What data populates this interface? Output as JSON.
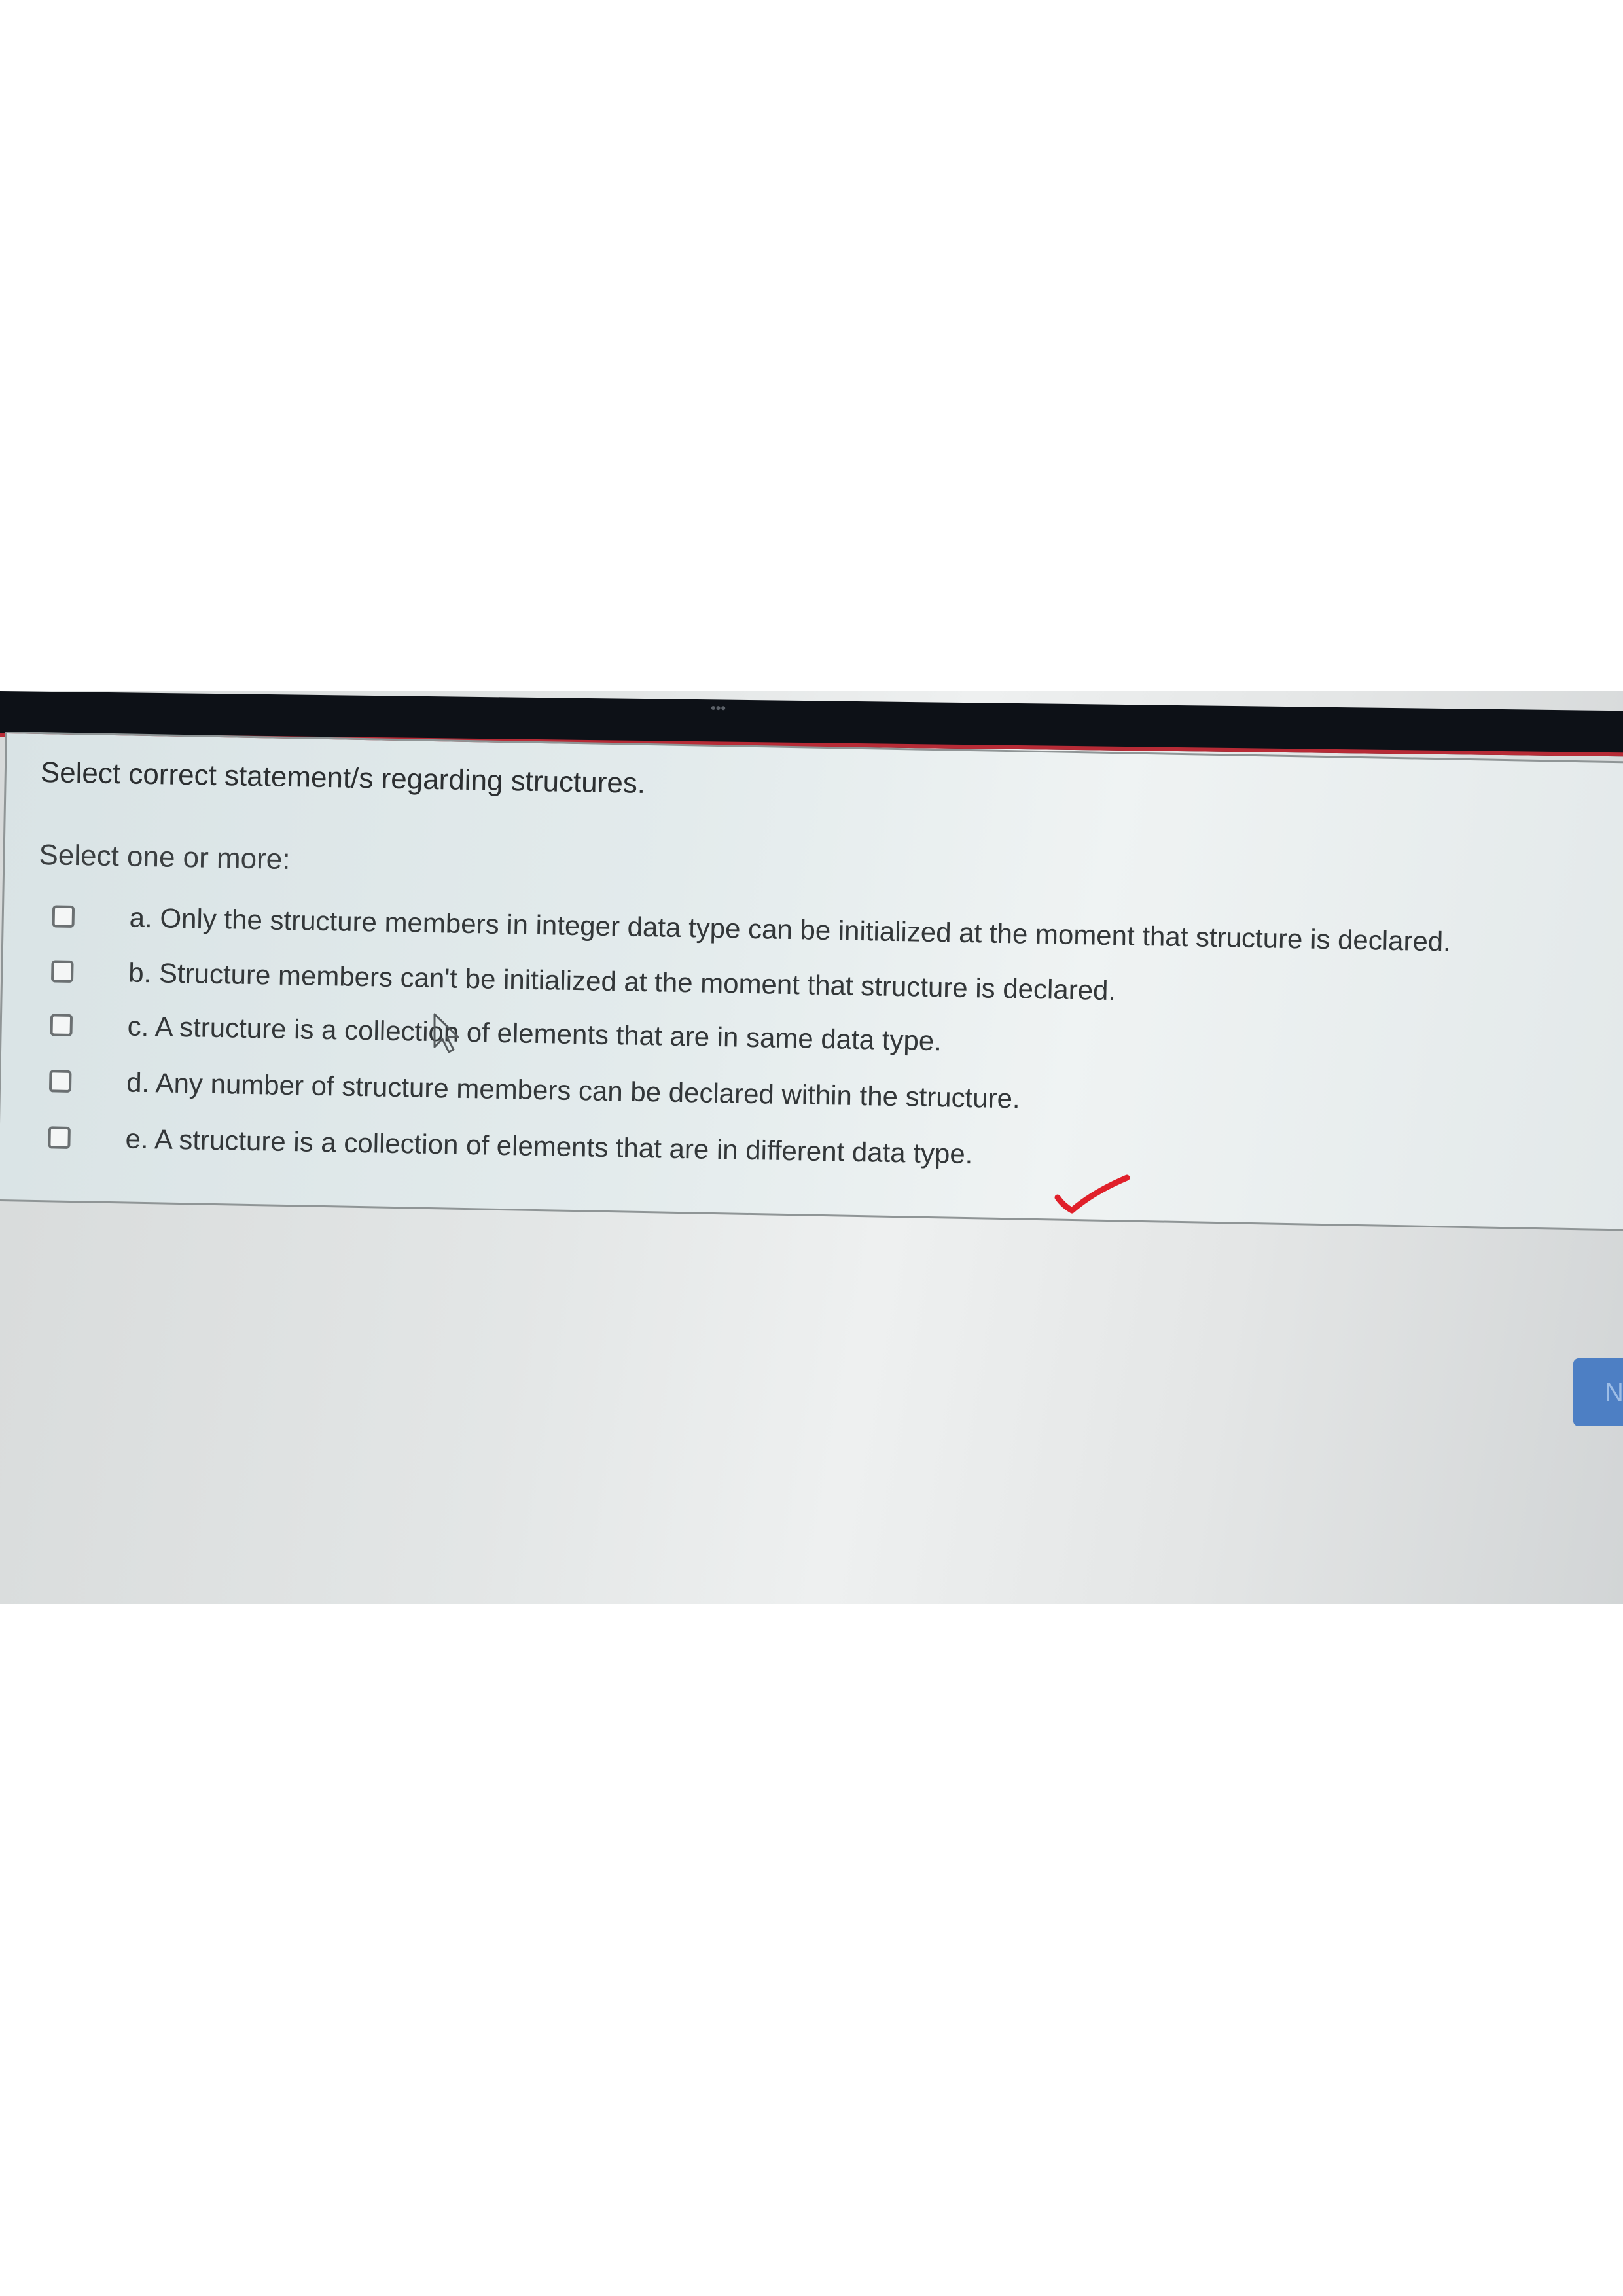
{
  "question": {
    "title": "Select correct statement/s regarding structures.",
    "select_hint": "Select one or more:",
    "options": [
      {
        "label": "a. Only the structure members in integer data type can be initialized at the moment that structure is declared.",
        "checked": false
      },
      {
        "label": "b. Structure members can't be initialized at the moment that structure is declared.",
        "checked": false
      },
      {
        "label": "c. A structure is a collection of elements that are in  same data type.",
        "checked": false
      },
      {
        "label": "d. Any number of structure members can be declared within the structure.",
        "checked": false
      },
      {
        "label": "e. A structure is a collection of elements that are in  different data type.",
        "checked": false
      }
    ]
  },
  "navigation": {
    "next_label": "N"
  },
  "top_bar": {
    "dots": "•••"
  },
  "annotation": {
    "check_mark_color": "#e0202a",
    "icon": "check-mark-icon"
  },
  "colors": {
    "top_bar": "#0d1117",
    "accent_red": "#b72b36",
    "next_button": "#4d7fc4"
  }
}
